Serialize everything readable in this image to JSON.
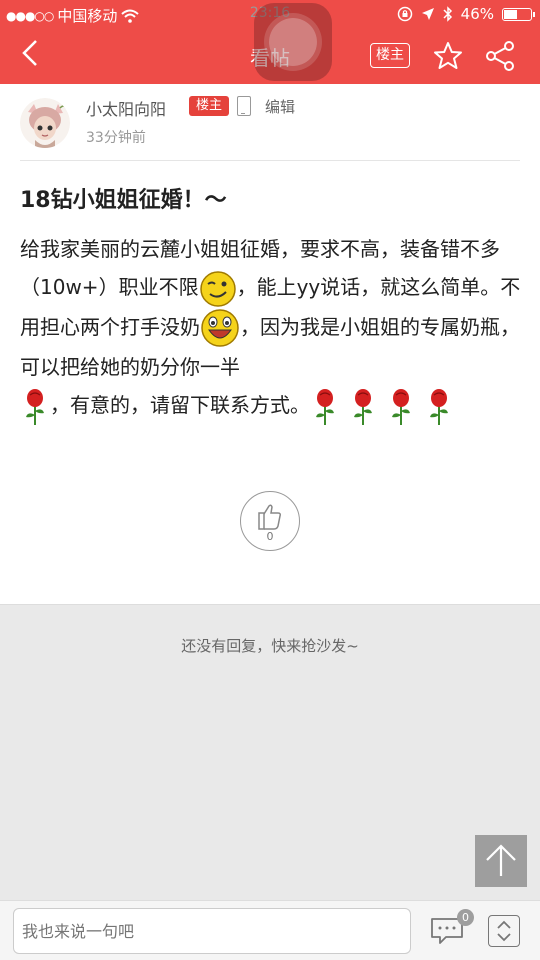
{
  "status_bar": {
    "carrier": "中国移动",
    "time": "23:16",
    "battery": "46%",
    "battery_level": 0.46
  },
  "nav": {
    "title": "看帖",
    "owner_button": "楼主"
  },
  "post": {
    "author": "小太阳向阳",
    "owner_badge": "楼主",
    "edit": "编辑",
    "time": "33分钟前",
    "title": "18钻小姐姐征婚！～",
    "body_1": "给我家美丽的云麓小姐姐征婚，要求不高，装备错不多（10w+）职业不限",
    "body_2": "，能上yy说话，就这么简单。不用担心两个打手没奶",
    "body_3": "，因为我是小姐姐的专属奶瓶，可以把给她的奶分你一半",
    "body_4": "，有意的，请留下联系方式。",
    "like_count": "0"
  },
  "replies": {
    "empty_text": "还没有回复，快来抢沙发~"
  },
  "bottom_bar": {
    "input_placeholder": "我也来说一句吧",
    "comment_count": "0"
  },
  "colors": {
    "brand": "#ee4c48",
    "badge": "#e5423b"
  }
}
